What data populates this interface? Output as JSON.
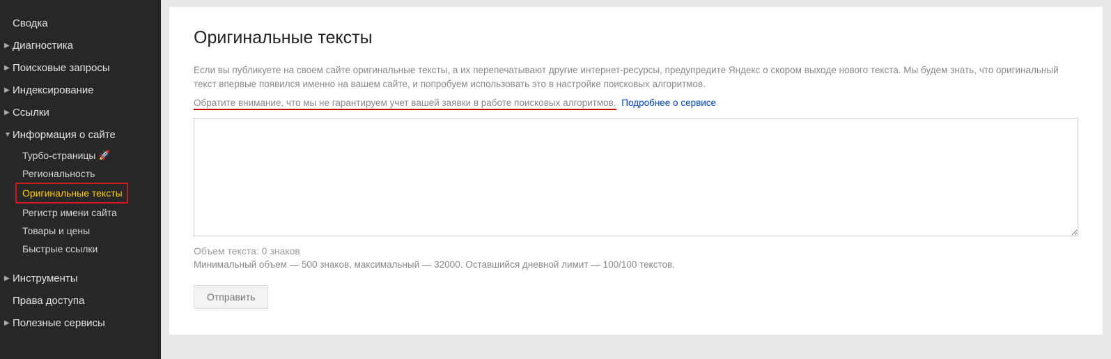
{
  "sidebar": {
    "items": [
      {
        "label": "Сводка",
        "has_children": false
      },
      {
        "label": "Диагностика",
        "has_children": true
      },
      {
        "label": "Поисковые запросы",
        "has_children": true
      },
      {
        "label": "Индексирование",
        "has_children": true
      },
      {
        "label": "Ссылки",
        "has_children": true
      },
      {
        "label": "Информация о сайте",
        "has_children": true,
        "expanded": true,
        "children": [
          {
            "label": "Турбо-страницы",
            "icon": "rocket"
          },
          {
            "label": "Региональность"
          },
          {
            "label": "Оригинальные тексты",
            "active": true
          },
          {
            "label": "Регистр имени сайта"
          },
          {
            "label": "Товары и цены"
          },
          {
            "label": "Быстрые ссылки"
          }
        ]
      },
      {
        "label": "Инструменты",
        "has_children": true
      },
      {
        "label": "Права доступа",
        "has_children": false
      },
      {
        "label": "Полезные сервисы",
        "has_children": true
      }
    ]
  },
  "main": {
    "title": "Оригинальные тексты",
    "intro": "Если вы публикуете на своем сайте оригинальные тексты, а их перепечатывают другие интернет-ресурсы, предупредите Яндекс о скором выходе нового текста. Мы будем знать, что оригинальный текст впервые появился именно на вашем сайте, и попробуем использовать это в настройке поисковых алгоритмов.",
    "notice_text": "Обратите внимание, что мы не гарантируем учет вашей заявки в работе поисковых алгоритмов.",
    "notice_link": "Подробнее о сервисе",
    "textarea_value": "",
    "counter": "Объем текста: 0 знаков",
    "limits": "Минимальный объем — 500 знаков, максимальный — 32000. Оставшийся дневной лимит — 100/100 текстов.",
    "submit_label": "Отправить"
  }
}
